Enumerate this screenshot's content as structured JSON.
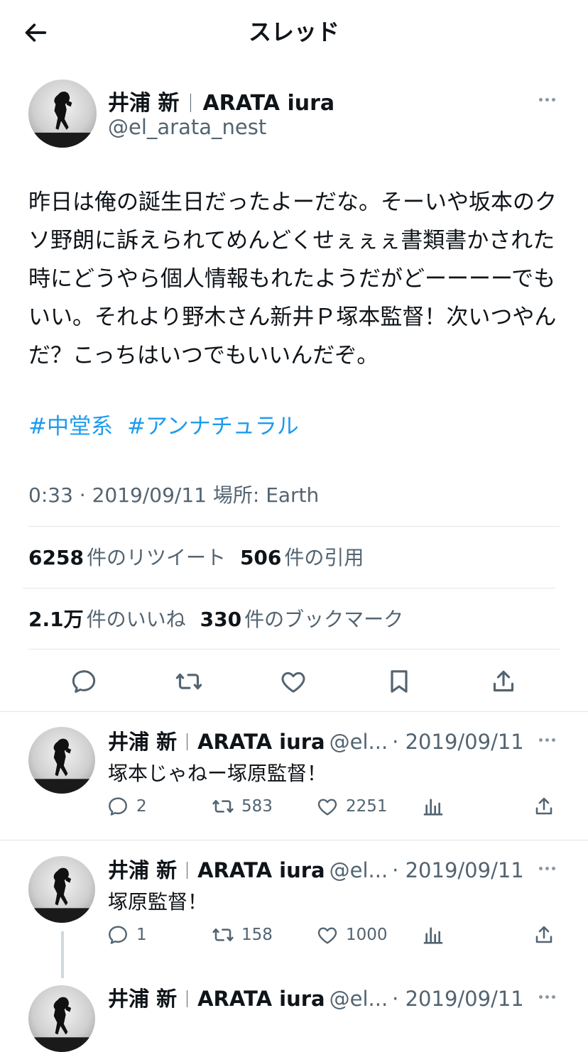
{
  "header": {
    "title": "スレッド"
  },
  "main_tweet": {
    "author_name": "井浦 新",
    "author_name_en": "ARATA iura",
    "handle": "@el_arata_nest",
    "text": "昨日は俺の誕生日だったよーだな。そーいや坂本のクソ野朗に訴えられてめんどくせぇぇぇ書類書かされた時にどうやら個人情報もれたようだがどーーーーでもいい。それより野木さん新井Ｐ塚本監督！次いつやんだ？こっちはいつでもいいんだぞ。",
    "hashtags": [
      "#中堂系",
      "#アンナチュラル"
    ],
    "meta": "0:33 · 2019/09/11 場所: Earth",
    "stats": {
      "retweets_count": "6258",
      "retweets_label": "件のリツイート",
      "quotes_count": "506",
      "quotes_label": "件の引用",
      "likes_count": "2.1万",
      "likes_label": "件のいいね",
      "bookmarks_count": "330",
      "bookmarks_label": "件のブックマーク"
    }
  },
  "replies": [
    {
      "author_name": "井浦 新",
      "author_name_en": "ARATA iura",
      "handle": "@el...",
      "date": "· 2019/09/11",
      "text": "塚本じゃねー塚原監督！",
      "reply_count": "2",
      "retweet_count": "583",
      "like_count": "2251"
    },
    {
      "author_name": "井浦 新",
      "author_name_en": "ARATA iura",
      "handle": "@el...",
      "date": "· 2019/09/11",
      "text": "塚原監督！",
      "reply_count": "1",
      "retweet_count": "158",
      "like_count": "1000"
    },
    {
      "author_name": "井浦 新",
      "author_name_en": "ARATA iura",
      "handle": "@el...",
      "date": "· 2019/09/11"
    }
  ],
  "icons": [
    "back-arrow-icon",
    "more-icon",
    "reply-icon",
    "retweet-icon",
    "like-icon",
    "bookmark-icon",
    "share-icon",
    "analytics-icon"
  ],
  "colors": {
    "text": "#0f1419",
    "secondary": "#536471",
    "link": "#1d9bf0",
    "divider": "#e1e6ea"
  }
}
